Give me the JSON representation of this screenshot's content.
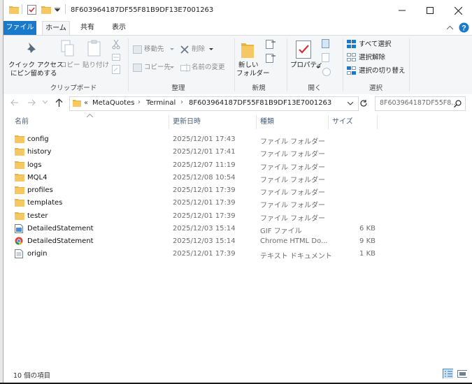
{
  "window": {
    "title": "8F603964187DF55F81B9DF13E7001263"
  },
  "ribbon_tabs": {
    "file": "ファイル",
    "home": "ホーム",
    "share": "共有",
    "view": "表示"
  },
  "ribbon": {
    "clipboard": {
      "quick_access": "クイック アクセス",
      "quick_access_2": "にピン留めする",
      "copy": "コピー",
      "paste": "貼り付け",
      "label": "クリップボード"
    },
    "organize": {
      "move_to": "移動先",
      "delete": "削除",
      "copy_to": "コピー先",
      "rename": "名前の変更",
      "label": "整理"
    },
    "new": {
      "new_folder": "新しい",
      "new_folder_2": "フォルダー",
      "label": "新規"
    },
    "open": {
      "properties": "プロパティ",
      "label": "開く"
    },
    "select": {
      "select_all": "すべて選択",
      "select_none": "選択解除",
      "invert": "選択の切り替え",
      "label": "選択"
    }
  },
  "address": {
    "prefix": "«",
    "crumbs": [
      "MetaQuotes",
      "Terminal",
      "8F603964187DF55F81B9DF13E7001263"
    ],
    "search_text": "8F603964187DF55F8..."
  },
  "columns": {
    "name": "名前",
    "date": "更新日時",
    "type": "種類",
    "size": "サイズ"
  },
  "files": [
    {
      "name": "config",
      "date": "2025/12/01 17:43",
      "type": "ファイル フォルダー",
      "size": "",
      "icon": "folder-icon"
    },
    {
      "name": "history",
      "date": "2025/12/01 17:41",
      "type": "ファイル フォルダー",
      "size": "",
      "icon": "folder-icon"
    },
    {
      "name": "logs",
      "date": "2025/12/07 11:19",
      "type": "ファイル フォルダー",
      "size": "",
      "icon": "folder-icon"
    },
    {
      "name": "MQL4",
      "date": "2025/12/08 10:54",
      "type": "ファイル フォルダー",
      "size": "",
      "icon": "folder-icon"
    },
    {
      "name": "profiles",
      "date": "2025/12/01 17:39",
      "type": "ファイル フォルダー",
      "size": "",
      "icon": "folder-icon"
    },
    {
      "name": "templates",
      "date": "2025/12/01 17:39",
      "type": "ファイル フォルダー",
      "size": "",
      "icon": "folder-icon"
    },
    {
      "name": "tester",
      "date": "2025/12/01 17:39",
      "type": "ファイル フォルダー",
      "size": "",
      "icon": "folder-icon"
    },
    {
      "name": "DetailedStatement",
      "date": "2025/12/03 15:14",
      "type": "GIF ファイル",
      "size": "6 KB",
      "icon": "gif-file-icon"
    },
    {
      "name": "DetailedStatement",
      "date": "2025/12/03 15:14",
      "type": "Chrome HTML Do...",
      "size": "9 KB",
      "icon": "chrome-html-icon"
    },
    {
      "name": "origin",
      "date": "2025/12/01 17:39",
      "type": "テキスト ドキュメント",
      "size": "1 KB",
      "icon": "text-file-icon"
    }
  ],
  "status": {
    "count": "10 個の項目"
  },
  "colors": {
    "accent": "#1979ca",
    "folder": "#f6c863"
  }
}
